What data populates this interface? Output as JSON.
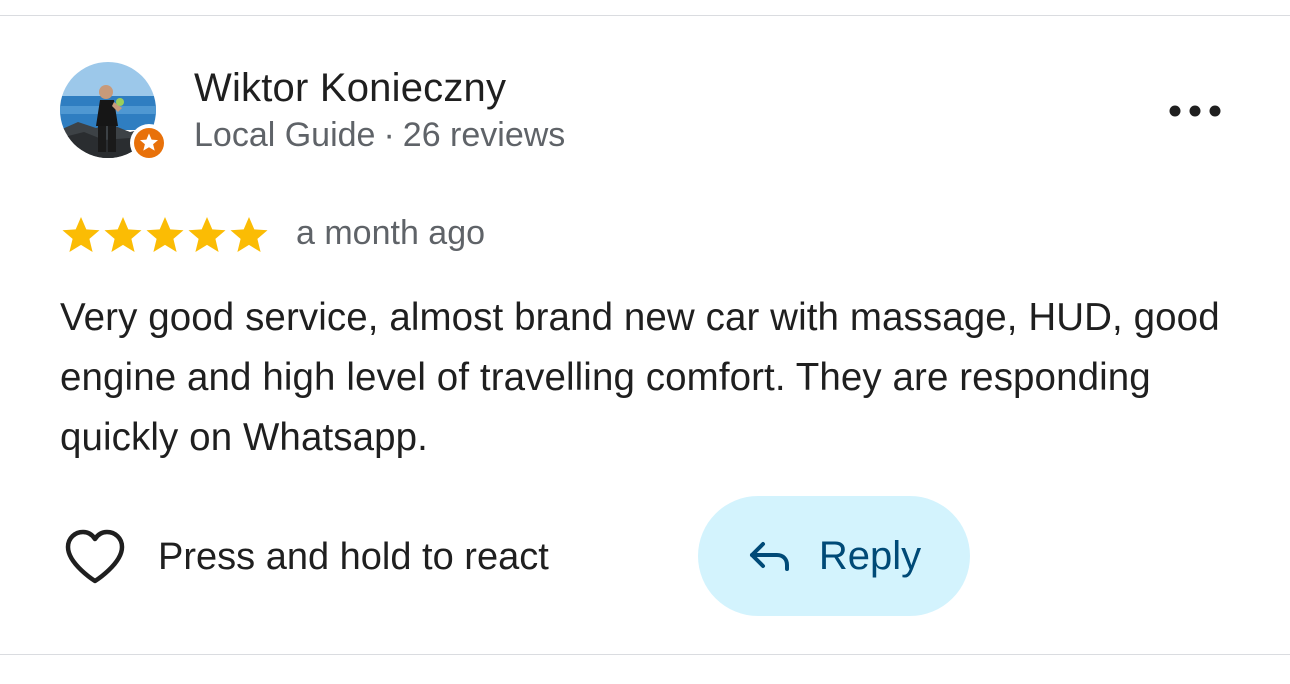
{
  "review": {
    "author": {
      "name": "Wiktor Konieczny",
      "badge": "Local Guide",
      "separator": "·",
      "review_count": "26 reviews",
      "avatar_icon": "profile-photo-icon",
      "badge_icon": "local-guide-star-icon"
    },
    "rating": {
      "stars": 5,
      "max": 5,
      "star_color": "#fbbc04",
      "timestamp": "a month ago"
    },
    "text": "Very good service, almost brand new car with massage, HUD, good engine and high level of travelling comfort. They are responding quickly on Whatsapp.",
    "actions": {
      "react_label": "Press and hold to react",
      "react_icon": "heart-outline-icon",
      "reply_label": "Reply",
      "reply_icon": "reply-arrow-icon",
      "more_icon": "more-options-icon"
    }
  },
  "colors": {
    "reply_background": "#d3f3fd",
    "reply_text": "#004a77",
    "guide_badge": "#e8710a",
    "secondary_text": "#5f6368"
  }
}
